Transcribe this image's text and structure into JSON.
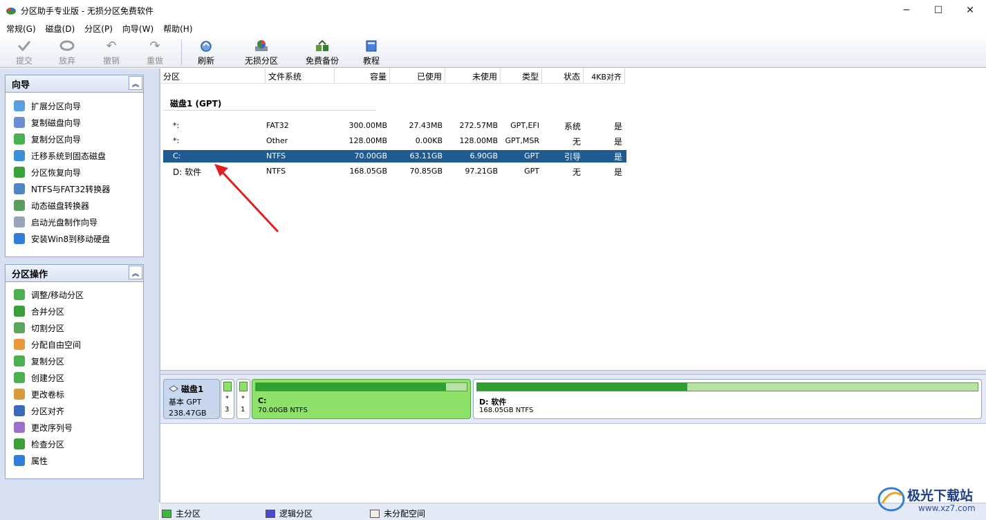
{
  "window": {
    "title": "分区助手专业版 - 无损分区免费软件",
    "minimize": "─",
    "maximize": "☐",
    "close": "✕"
  },
  "menu": [
    "常规(G)",
    "磁盘(D)",
    "分区(P)",
    "向导(W)",
    "帮助(H)"
  ],
  "toolbar": {
    "commit": "提交",
    "discard": "放弃",
    "undo": "撤销",
    "redo": "重做",
    "refresh": "刷新",
    "lossless": "无损分区",
    "backup": "免费备份",
    "tutorial": "教程"
  },
  "wizard_panel": {
    "title": "向导",
    "items": [
      "扩展分区向导",
      "复制磁盘向导",
      "复制分区向导",
      "迁移系统到固态磁盘",
      "分区恢复向导",
      "NTFS与FAT32转换器",
      "动态磁盘转换器",
      "启动光盘制作向导",
      "安装Win8到移动硬盘"
    ]
  },
  "ops_panel": {
    "title": "分区操作",
    "items": [
      "调整/移动分区",
      "合并分区",
      "切割分区",
      "分配自由空间",
      "复制分区",
      "创建分区",
      "更改卷标",
      "分区对齐",
      "更改序列号",
      "检查分区",
      "属性"
    ]
  },
  "table": {
    "headers": [
      "分区",
      "文件系统",
      "容量",
      "已使用",
      "未使用",
      "类型",
      "状态",
      "4KB对齐"
    ],
    "disk_label": "磁盘1 (GPT)",
    "rows": [
      {
        "name": "*:",
        "fs": "FAT32",
        "cap": "300.00MB",
        "used": "27.43MB",
        "free": "272.57MB",
        "type": "GPT,EFI",
        "status": "系统",
        "align": "是"
      },
      {
        "name": "*:",
        "fs": "Other",
        "cap": "128.00MB",
        "used": "0.00KB",
        "free": "128.00MB",
        "type": "GPT,MSR",
        "status": "无",
        "align": "是"
      },
      {
        "name": "C:",
        "fs": "NTFS",
        "cap": "70.00GB",
        "used": "63.11GB",
        "free": "6.90GB",
        "type": "GPT",
        "status": "引导",
        "align": "是"
      },
      {
        "name": "D: 软件",
        "fs": "NTFS",
        "cap": "168.05GB",
        "used": "70.85GB",
        "free": "97.21GB",
        "type": "GPT",
        "status": "无",
        "align": "是"
      }
    ],
    "selected_row": 2
  },
  "diskmap": {
    "disk_name": "磁盘1",
    "disk_type": "基本 GPT",
    "disk_size": "238.47GB",
    "small1_mark": "*",
    "small1_num": "3",
    "small2_mark": "*",
    "small2_num": "1",
    "c_label": "C:",
    "c_info": "70.00GB NTFS",
    "c_used_fraction": 0.9,
    "d_label": "D: 软件",
    "d_info": "168.05GB NTFS",
    "d_used_fraction": 0.42
  },
  "legend": {
    "primary": "主分区",
    "logical": "逻辑分区",
    "unallocated": "未分配空间"
  },
  "watermark": {
    "brand": "极光下载站",
    "url": "www.xz7.com"
  },
  "colors": {
    "selection": "#1f5a93",
    "primary_green": "#8ee26a",
    "logical_blue": "#4b4bd0",
    "arrow_red": "#e02020"
  }
}
